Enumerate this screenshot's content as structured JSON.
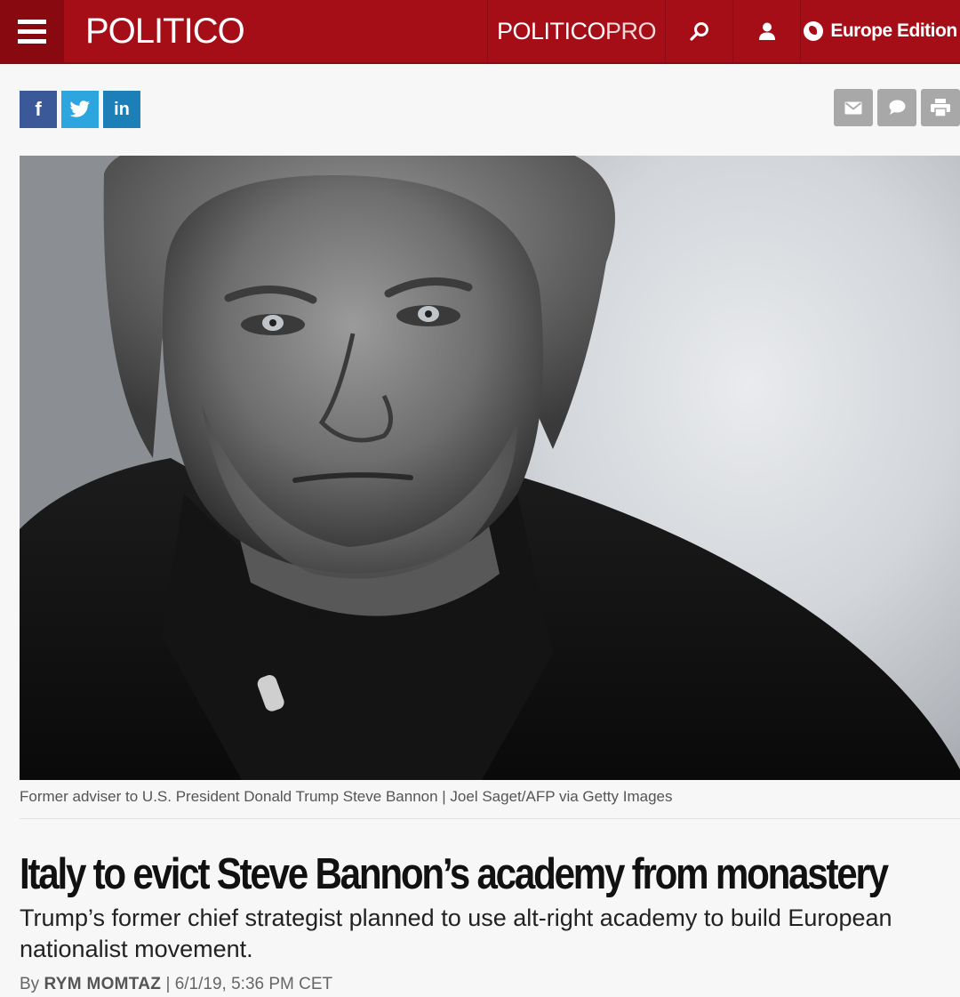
{
  "header": {
    "logo": "POLITICO",
    "pro_logo_main": "POLITICO",
    "pro_logo_suffix": "PRO",
    "edition_label": "Europe Edition",
    "icons": [
      "menu-icon",
      "search-icon",
      "user-icon",
      "globe-icon"
    ]
  },
  "share": {
    "facebook": "f",
    "twitter": "twitter-icon",
    "linkedin": "in",
    "tools": [
      "mail-icon",
      "comment-icon",
      "print-icon"
    ]
  },
  "article": {
    "image_caption": "Former adviser to U.S. President Donald Trump Steve Bannon | Joel Saget/AFP via Getty Images",
    "headline": "Italy to evict Steve Bannon’s academy from monastery",
    "dek": "Trump’s former chief strategist planned to use alt-right academy to build European nationalist movement.",
    "byline_prefix": "By ",
    "author": "RYM MOMTAZ",
    "dateline": " | 6/1/19, 5:36 PM CET"
  },
  "colors": {
    "brand_red": "#a50d17",
    "facebook": "#3b5998",
    "twitter": "#2da6e0",
    "linkedin": "#1c7fb8"
  }
}
